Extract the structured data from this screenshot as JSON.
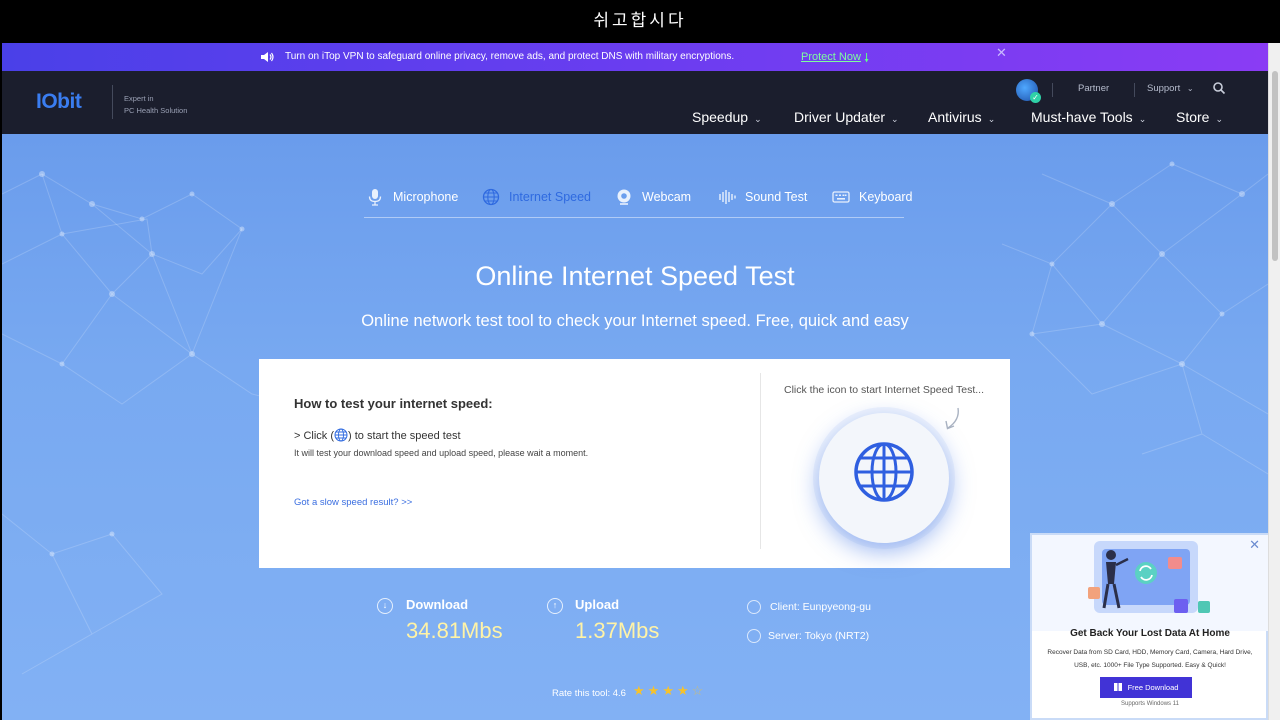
{
  "caption": "쉬고합시다",
  "promo": {
    "message_pre": "Turn on ",
    "message_brand": "iTop VPN",
    "message_post": " to safeguard online privacy, remove ads, and protect DNS with military encryptions.",
    "cta": "Protect Now",
    "close": "✕"
  },
  "nav": {
    "logo": "IObit",
    "tagline_line1": "Expert in",
    "tagline_line2": "PC Health Solution",
    "partner": "Partner",
    "support": "Support",
    "menu": [
      {
        "label": "Speedup"
      },
      {
        "label": "Driver Updater"
      },
      {
        "label": "Antivirus"
      },
      {
        "label": "Must-have Tools"
      },
      {
        "label": "Store"
      }
    ]
  },
  "tabs": [
    {
      "label": "Microphone",
      "icon": "microphone-icon",
      "active": false
    },
    {
      "label": "Internet Speed",
      "icon": "globe-icon",
      "active": true
    },
    {
      "label": "Webcam",
      "icon": "webcam-icon",
      "active": false
    },
    {
      "label": "Sound Test",
      "icon": "soundwave-icon",
      "active": false
    },
    {
      "label": "Keyboard",
      "icon": "keyboard-icon",
      "active": false
    }
  ],
  "hero": {
    "title": "Online Internet Speed Test",
    "subtitle": "Online network test tool to check your Internet speed. Free, quick and easy"
  },
  "card": {
    "how_title": "How to test your internet speed:",
    "step_pre": "> Click (",
    "step_post": ") to start the speed test",
    "desc": "It will test your download speed and upload speed, please wait a moment.",
    "slow_link": "Got a slow speed result? >>",
    "hint": "Click the icon to start Internet Speed Test..."
  },
  "stats": {
    "download_label": "Download",
    "download_value": "34.81Mbs",
    "upload_label": "Upload",
    "upload_value": "1.37Mbs",
    "client": "Client: Eunpyeong-gu",
    "server": "Server: Tokyo (NRT2)"
  },
  "rating": {
    "text": "Rate this tool: 4.6",
    "value": 4.6,
    "max": 5
  },
  "popup": {
    "title": "Get Back Your Lost Data At Home",
    "desc": "Recover Data from SD Card, HDD, Memory Card, Camera, Hard Drive, USB, etc. 1000+ File Type Supported. Easy & Quick!",
    "button": "Free Download",
    "small": "Supports Windows 11",
    "close": "✕"
  },
  "colors": {
    "promo_bar": "#5b3ef0",
    "nav_bg": "#1b1e2d",
    "accent_blue": "#2f6ae0",
    "value_yellow": "#fff3a6",
    "star": "#f6c22c",
    "popup_button": "#4133d6"
  }
}
